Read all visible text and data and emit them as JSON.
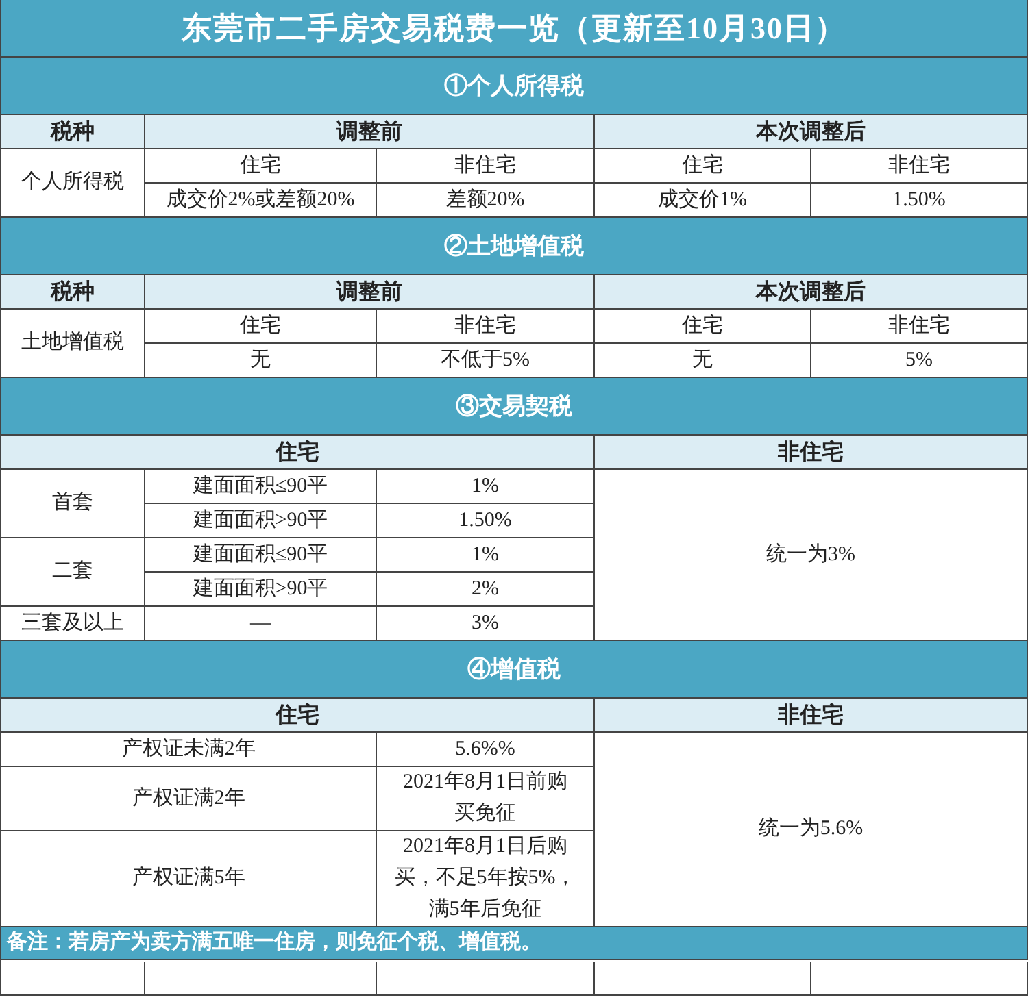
{
  "title": "东莞市二手房交易税费一览（更新至10月30日）",
  "sections": [
    {
      "heading": "①个人所得税",
      "rows": [
        [
          {
            "text": "税种",
            "kind": "head"
          },
          {
            "text": "调整前",
            "kind": "head",
            "colspan": 2
          },
          {
            "text": "本次调整后",
            "kind": "head",
            "colspan": 2
          }
        ],
        [
          {
            "text": "个人所得税",
            "kind": "cell",
            "rowspan": 2
          },
          {
            "text": "住宅",
            "kind": "cell"
          },
          {
            "text": "非住宅",
            "kind": "cell"
          },
          {
            "text": "住宅",
            "kind": "cell"
          },
          {
            "text": "非住宅",
            "kind": "cell"
          }
        ],
        [
          {
            "text": "成交价2%或差额20%",
            "kind": "cell"
          },
          {
            "text": "差额20%",
            "kind": "cell"
          },
          {
            "text": "成交价1%",
            "kind": "cell"
          },
          {
            "text": "1.50%",
            "kind": "cell"
          }
        ]
      ]
    },
    {
      "heading": "②土地增值税",
      "rows": [
        [
          {
            "text": "税种",
            "kind": "head"
          },
          {
            "text": "调整前",
            "kind": "head",
            "colspan": 2
          },
          {
            "text": "本次调整后",
            "kind": "head",
            "colspan": 2
          }
        ],
        [
          {
            "text": "土地增值税",
            "kind": "cell",
            "rowspan": 2
          },
          {
            "text": "住宅",
            "kind": "cell"
          },
          {
            "text": "非住宅",
            "kind": "cell"
          },
          {
            "text": "住宅",
            "kind": "cell"
          },
          {
            "text": "非住宅",
            "kind": "cell"
          }
        ],
        [
          {
            "text": "无",
            "kind": "cell"
          },
          {
            "text": "不低于5%",
            "kind": "cell"
          },
          {
            "text": "无",
            "kind": "cell"
          },
          {
            "text": "5%",
            "kind": "cell"
          }
        ]
      ]
    },
    {
      "heading": "③交易契税",
      "rows": [
        [
          {
            "text": "住宅",
            "kind": "head",
            "colspan": 3
          },
          {
            "text": "非住宅",
            "kind": "head",
            "colspan": 2
          }
        ],
        [
          {
            "text": "首套",
            "kind": "cell",
            "rowspan": 2
          },
          {
            "text": "建面面积≤90平",
            "kind": "cell"
          },
          {
            "text": "1%",
            "kind": "cell"
          },
          {
            "text": "统一为3%",
            "kind": "cell",
            "colspan": 2,
            "rowspan": 5
          }
        ],
        [
          {
            "text": "建面面积>90平",
            "kind": "cell"
          },
          {
            "text": "1.50%",
            "kind": "cell"
          }
        ],
        [
          {
            "text": "二套",
            "kind": "cell",
            "rowspan": 2
          },
          {
            "text": "建面面积≤90平",
            "kind": "cell"
          },
          {
            "text": "1%",
            "kind": "cell"
          }
        ],
        [
          {
            "text": "建面面积>90平",
            "kind": "cell"
          },
          {
            "text": "2%",
            "kind": "cell"
          }
        ],
        [
          {
            "text": "三套及以上",
            "kind": "cell"
          },
          {
            "text": "—",
            "kind": "cell"
          },
          {
            "text": "3%",
            "kind": "cell"
          }
        ]
      ]
    },
    {
      "heading": "④增值税",
      "rows": [
        [
          {
            "text": "住宅",
            "kind": "head",
            "colspan": 3
          },
          {
            "text": "非住宅",
            "kind": "head",
            "colspan": 2
          }
        ],
        [
          {
            "text": "产权证未满2年",
            "kind": "cell",
            "colspan": 2
          },
          {
            "text": "5.6%%",
            "kind": "cell"
          },
          {
            "text": "统一为5.6%",
            "kind": "cell",
            "colspan": 2,
            "rowspan": 3
          }
        ],
        [
          {
            "text": "产权证满2年",
            "kind": "cell",
            "colspan": 2
          },
          {
            "text": "2021年8月1日前购买免征",
            "kind": "cell"
          }
        ],
        [
          {
            "text": "产权证满5年",
            "kind": "cell",
            "colspan": 2
          },
          {
            "text": "2021年8月1日后购买，不足5年按5%，满5年后免征",
            "kind": "cell"
          }
        ]
      ]
    }
  ],
  "note": "备注：若房产为卖方满五唯一住房，则免征个税、增值税。"
}
